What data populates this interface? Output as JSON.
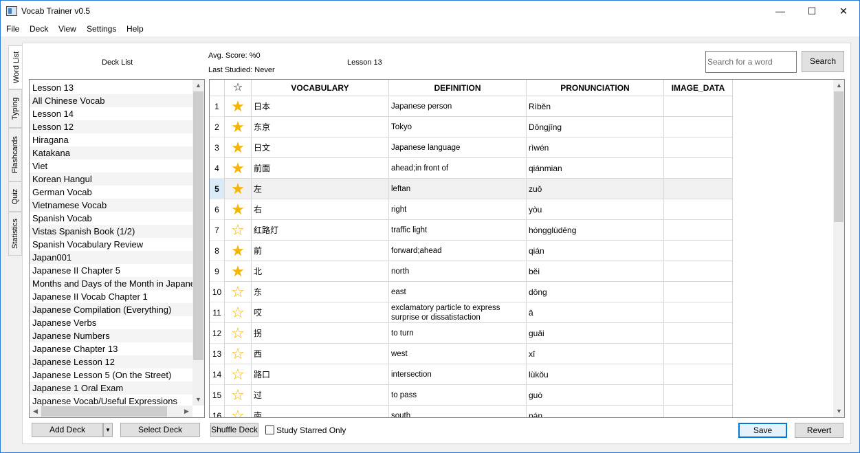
{
  "window": {
    "title": "Vocab Trainer v0.5",
    "controls": {
      "minimize": "—",
      "maximize": "☐",
      "close": "✕"
    }
  },
  "menu": [
    "File",
    "Deck",
    "View",
    "Settings",
    "Help"
  ],
  "side_tabs": [
    "Word List",
    "Typing",
    "Flashcards",
    "Quiz",
    "Statistics"
  ],
  "header": {
    "deck_list_label": "Deck List",
    "avg_score": "Avg. Score: %0",
    "last_studied": "Last Studied: Never",
    "lesson_label": "Lesson 13",
    "search_placeholder": "Search for a word",
    "search_button": "Search"
  },
  "decks": [
    "Lesson 13",
    "All Chinese Vocab",
    "Lesson 14",
    "Lesson 12",
    "Hiragana",
    "Katakana",
    "Viet",
    "Korean Hangul",
    "German Vocab",
    "Vietnamese Vocab",
    "Spanish Vocab",
    "Vistas Spanish Book (1/2)",
    "Spanish Vocabulary Review",
    "Japan001",
    "Japanese II Chapter 5",
    "Months and Days of the Month in Japanese",
    "Japanese II Vocab Chapter 1",
    "Japanese Compilation (Everything)",
    "Japanese Verbs",
    "Japanese Numbers",
    "Japanese Chapter 13",
    "Japanese Lesson 12",
    "Japanese Lesson 5 (On the Street)",
    "Japanese 1 Oral Exam",
    "Japanese Vocab/Useful Expressions"
  ],
  "table": {
    "star_header_icon": "☆",
    "columns": [
      "VOCABULARY",
      "DEFINITION",
      "PRONUNCIATION",
      "IMAGE_DATA"
    ],
    "selected_row": 5,
    "rows": [
      {
        "n": "1",
        "starred": true,
        "vocab": "日本",
        "def": "Japanese person",
        "pron": "Rìběn"
      },
      {
        "n": "2",
        "starred": true,
        "vocab": "东京",
        "def": "Tokyo",
        "pron": "Dōngjīng"
      },
      {
        "n": "3",
        "starred": true,
        "vocab": "日文",
        "def": "Japanese language",
        "pron": "rìwén"
      },
      {
        "n": "4",
        "starred": true,
        "vocab": "前面",
        "def": "ahead;in front of",
        "pron": "qiánmian"
      },
      {
        "n": "5",
        "starred": true,
        "vocab": "左",
        "def": "leftan",
        "pron": "zuǒ"
      },
      {
        "n": "6",
        "starred": true,
        "vocab": "右",
        "def": "right",
        "pron": "yòu"
      },
      {
        "n": "7",
        "starred": false,
        "vocab": "红路灯",
        "def": "traffic light",
        "pron": "hóngglùdēng"
      },
      {
        "n": "8",
        "starred": true,
        "vocab": "前",
        "def": "forward;ahead",
        "pron": "qián"
      },
      {
        "n": "9",
        "starred": true,
        "vocab": "北",
        "def": "north",
        "pron": "běi"
      },
      {
        "n": "10",
        "starred": false,
        "vocab": "东",
        "def": "east",
        "pron": "dōng"
      },
      {
        "n": "11",
        "starred": false,
        "vocab": "哎",
        "def": "exclamatory particle to express surprise or dissatistaction",
        "pron": "ā"
      },
      {
        "n": "12",
        "starred": false,
        "vocab": "拐",
        "def": "to turn",
        "pron": "guǎi"
      },
      {
        "n": "13",
        "starred": false,
        "vocab": "西",
        "def": "west",
        "pron": "xī"
      },
      {
        "n": "14",
        "starred": false,
        "vocab": "路口",
        "def": "intersection",
        "pron": "lùkǒu"
      },
      {
        "n": "15",
        "starred": false,
        "vocab": "过",
        "def": "to pass",
        "pron": "guò"
      },
      {
        "n": "16",
        "starred": false,
        "vocab": "南",
        "def": "south",
        "pron": "nán"
      }
    ]
  },
  "footer": {
    "add_deck": "Add Deck",
    "dropdown_arrow": "▼",
    "select_deck": "Select Deck",
    "shuffle_deck": "Shuffle Deck",
    "study_starred_only": "Study Starred Only",
    "save": "Save",
    "revert": "Revert"
  },
  "colors": {
    "accent": "#0078d7",
    "star": "#f5b400",
    "selected_row": "#f0f0f0"
  }
}
